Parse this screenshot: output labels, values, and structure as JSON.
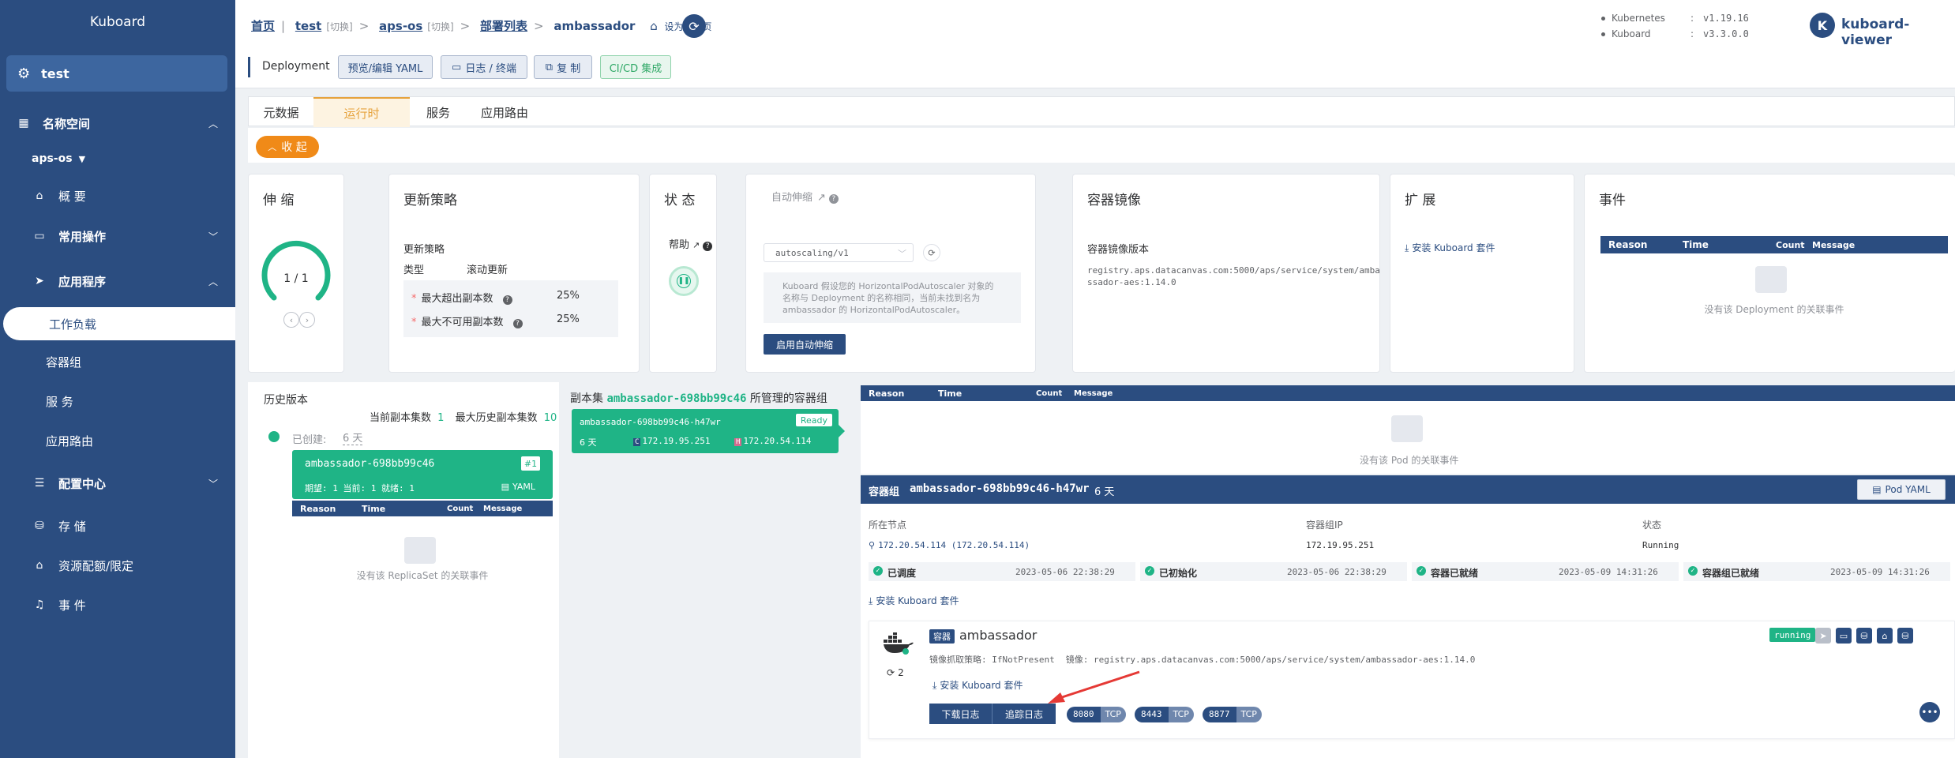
{
  "sidebar": {
    "brand": "Kuboard",
    "cluster": "test",
    "namespace_header": "名称空间",
    "namespace": "aps-os",
    "items": [
      {
        "label": "概 要"
      },
      {
        "label": "常用操作"
      },
      {
        "label": "应用程序"
      },
      {
        "label": "工作负载"
      },
      {
        "label": "容器组"
      },
      {
        "label": "服 务"
      },
      {
        "label": "应用路由"
      },
      {
        "label": "配置中心"
      },
      {
        "label": "存 储"
      },
      {
        "label": "资源配额/限定"
      },
      {
        "label": "事 件"
      }
    ]
  },
  "header": {
    "breadcrumb": {
      "home": "首页",
      "cluster": "test",
      "cluster_switch": "[切换]",
      "namespace": "aps-os",
      "namespace_switch": "[切换]",
      "list": "部署列表",
      "current": "ambassador",
      "set_default": "设为默认页"
    },
    "kind": "Deployment",
    "toolbar": {
      "yaml": "预览/编辑 YAML",
      "logs": "日志 / 终端",
      "copy": "复 制",
      "cicd": "CI/CD 集成"
    },
    "versions": [
      {
        "name": "Kubernetes",
        "value": "v1.19.16"
      },
      {
        "name": "Kuboard",
        "value": "v3.3.0.0"
      }
    ],
    "user": {
      "avatar": "K",
      "name": "kuboard-viewer"
    }
  },
  "tabs": [
    "元数据",
    "运行时",
    "服务",
    "应用路由"
  ],
  "active_tab": "运行时",
  "collapse_label": "收 起",
  "scale": {
    "title": "伸 缩",
    "value": "1 / 1"
  },
  "strategy": {
    "title": "更新策略",
    "subtitle": "更新策略",
    "type_label": "类型",
    "type_value": "滚动更新",
    "max_surge_label": "最大超出副本数",
    "max_surge": "25%",
    "max_unavailable_label": "最大不可用副本数",
    "max_unavailable": "25%"
  },
  "status": {
    "title": "状 态",
    "help": "帮助"
  },
  "autoscale": {
    "title": "自动伸缩",
    "select_value": "autoscaling/v1",
    "note": "Kuboard 假设您的 HorizontalPodAutoscaler 对象的名称与 Deployment 的名称相同，当前未找到名为 ambassador 的 HorizontalPodAutoscaler。",
    "enable_button": "启用自动伸缩"
  },
  "image": {
    "title": "容器镜像",
    "version_label": "容器镜像版本",
    "value": "registry.aps.datacanvas.com:5000/aps/service/system/ambassador-aes:1.14.0"
  },
  "extension": {
    "title": "扩 展",
    "install": "安装 Kuboard 套件"
  },
  "events": {
    "title": "事件",
    "columns": [
      "Reason",
      "Time",
      "Count",
      "Message"
    ],
    "empty": "没有该 Deployment 的关联事件"
  },
  "history": {
    "title": "历史版本",
    "current_replicas_label": "当前副本集数",
    "current_replicas": "1",
    "max_history_label": "最大历史副本集数",
    "max_history": "10",
    "created_label": "已创建:",
    "created_value": "6 天",
    "rs_name": "ambassador-698bb99c46",
    "rs_badge": "#1",
    "rs_stats": "期望: 1 当前: 1 就绪: 1",
    "rs_yaml": "YAML",
    "empty": "没有该 ReplicaSet 的关联事件"
  },
  "replicaset": {
    "title_prefix": "副本集",
    "name": "ambassador-698bb99c46",
    "title_suffix": "所管理的容器组",
    "pod_name": "ambassador-698bb99c46-h47wr",
    "pod_status": "Ready",
    "pod_age": "6 天",
    "pod_ip": "172.19.95.251",
    "host_ip": "172.20.54.114"
  },
  "pod_events": {
    "empty": "没有该 Pod 的关联事件"
  },
  "pod": {
    "header_label": "容器组",
    "name": "ambassador-698bb99c46-h47wr",
    "age": "6 天",
    "yaml_button": "Pod YAML",
    "node_label": "所在节点",
    "node_value": "172.20.54.114 (172.20.54.114)",
    "ip_label": "容器组IP",
    "ip_value": "172.19.95.251",
    "state_label": "状态",
    "state_value": "Running",
    "conditions": [
      {
        "label": "已调度",
        "time": "2023-05-06 22:38:29"
      },
      {
        "label": "已初始化",
        "time": "2023-05-06 22:38:29"
      },
      {
        "label": "容器已就绪",
        "time": "2023-05-09 14:31:26"
      },
      {
        "label": "容器组已就绪",
        "time": "2023-05-09 14:31:26"
      }
    ],
    "install": "安装 Kuboard 套件"
  },
  "container": {
    "tag": "容器",
    "name": "ambassador",
    "restarts": "2",
    "pull_policy": "镜像抓取策略: IfNotPresent",
    "image_label": "镜像:",
    "image": "registry.aps.datacanvas.com:5000/aps/service/system/ambassador-aes:1.14.0",
    "install": "安装 Kuboard 套件",
    "download_logs": "下载日志",
    "tail_logs": "追踪日志",
    "state": "running",
    "ports": [
      {
        "port": "8080",
        "proto": "TCP"
      },
      {
        "port": "8443",
        "proto": "TCP"
      },
      {
        "port": "8877",
        "proto": "TCP"
      }
    ]
  }
}
